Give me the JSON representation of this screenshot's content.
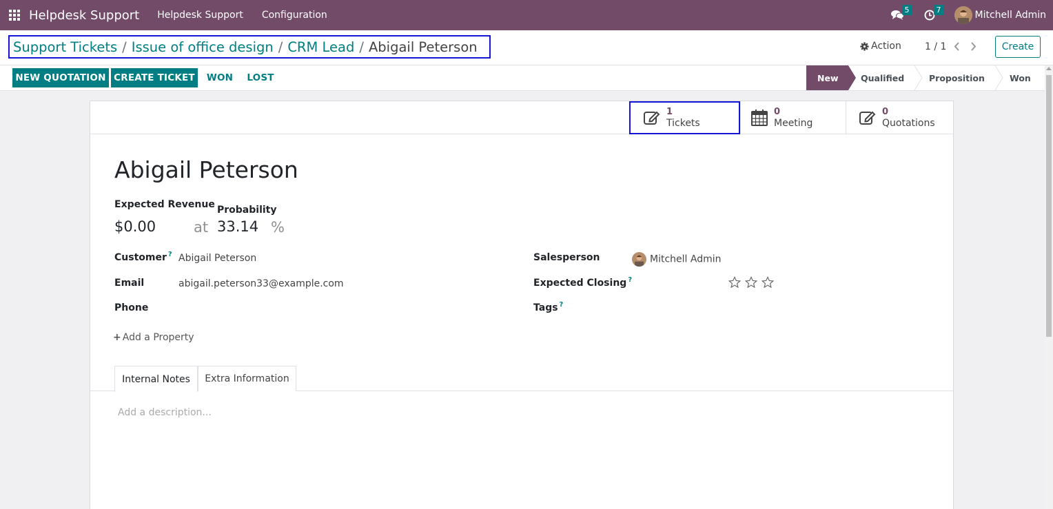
{
  "navbar": {
    "app_name": "Helpdesk Support",
    "menus": [
      "Helpdesk Support",
      "Configuration"
    ],
    "messages_count": "5",
    "activities_count": "7",
    "user_name": "Mitchell Admin",
    "bg_color": "#714b67"
  },
  "breadcrumb": {
    "items": [
      "Support Tickets",
      "Issue of office design",
      "CRM Lead"
    ],
    "separator": "/",
    "current": "Abigail Peterson"
  },
  "control": {
    "action_label": "Action",
    "pager": "1 / 1",
    "create_label": "Create"
  },
  "statusbar": {
    "buttons": [
      "New Quotation",
      "Create Ticket",
      "Won",
      "Lost"
    ],
    "stages": [
      "New",
      "Qualified",
      "Proposition",
      "Won"
    ],
    "active_stage": "New"
  },
  "smart_buttons": [
    {
      "value": "1",
      "label": "Tickets",
      "icon": "edit-icon"
    },
    {
      "value": "0",
      "label": "Meeting",
      "icon": "calendar-icon"
    },
    {
      "value": "0",
      "label": "Quotations",
      "icon": "edit-icon"
    }
  ],
  "lead": {
    "name": "Abigail Peterson",
    "expected_revenue_label": "Expected Revenue",
    "expected_revenue": "$0.00",
    "at_label": "at",
    "probability_label": "Probability",
    "probability": "33.14",
    "percent": "%",
    "customer_label": "Customer",
    "customer": "Abigail Peterson",
    "email_label": "Email",
    "email": "abigail.peterson33@example.com",
    "phone_label": "Phone",
    "phone": "",
    "salesperson_label": "Salesperson",
    "salesperson": "Mitchell Admin",
    "expected_closing_label": "Expected Closing",
    "priority_stars": 0,
    "tags_label": "Tags",
    "help_mark": "?",
    "add_property": "Add a Property"
  },
  "notebook": {
    "tabs": [
      "Internal Notes",
      "Extra Information"
    ],
    "description_placeholder": "Add a description..."
  },
  "colors": {
    "accent": "#017e84",
    "brand": "#714b67",
    "highlight": "#1414d6"
  }
}
